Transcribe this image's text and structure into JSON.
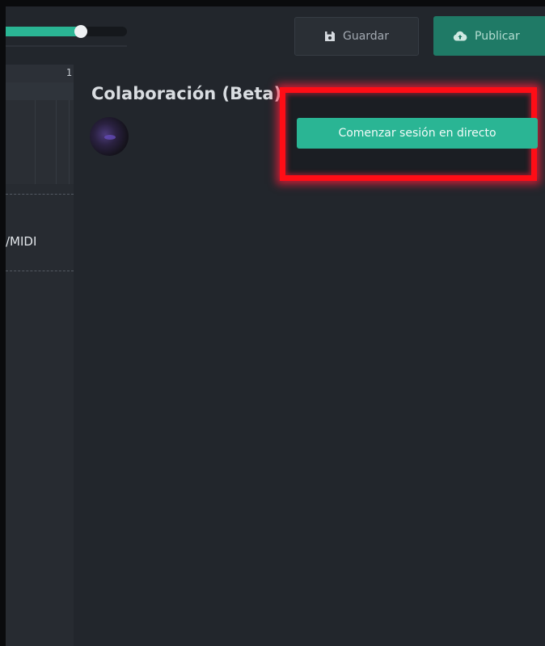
{
  "toolbar": {
    "progress_value": 0.62,
    "save_label": "Guardar",
    "save_icon": "floppy-disk-icon",
    "publish_label": "Publicar",
    "publish_icon": "cloud-upload-icon"
  },
  "timeline": {
    "ruler_marker": "1",
    "track_label": "/MIDI"
  },
  "collab": {
    "title": "Colaboración (Beta)",
    "avatar": "user-avatar",
    "start_live_label": "Comenzar sesión en directo"
  },
  "colors": {
    "accent": "#2ab594",
    "background": "#22262c",
    "highlight": "#ff0d16"
  }
}
